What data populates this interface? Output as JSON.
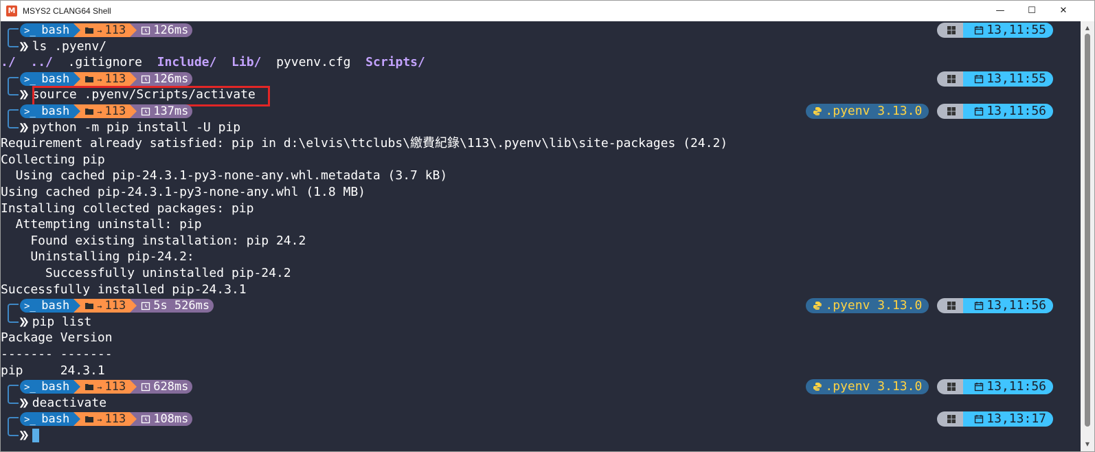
{
  "window": {
    "title": "MSYS2 CLANG64 Shell",
    "icon_letter": "M",
    "minimize_glyph": "—",
    "maximize_glyph": "☐",
    "close_glyph": "✕"
  },
  "prompt": {
    "shell": "bash",
    "dir": "113",
    "shell_icon": ">_",
    "dir_icon": "folder-arrow-icon",
    "timer_icon": "timer-icon",
    "os_icon": "windows-icon",
    "date_icon": "calendar-icon",
    "python_icon": "python-icon",
    "env": ".pyenv 3.13.0",
    "chevron": "❯❯"
  },
  "blocks": [
    {
      "time": "126ms",
      "clock": "13,11:55",
      "show_env": false,
      "command": "ls .pyenv/",
      "output_ls": [
        "./",
        "../",
        ".gitignore",
        "Include/",
        "Lib/",
        "pyvenv.cfg",
        "Scripts/"
      ]
    },
    {
      "time": "126ms",
      "clock": "13,11:55",
      "show_env": false,
      "command": "source .pyenv/Scripts/activate",
      "output": []
    },
    {
      "time": "137ms",
      "clock": "13,11:56",
      "show_env": true,
      "command": "python -m pip install -U pip",
      "output": [
        "Requirement already satisfied: pip in d:\\elvis\\ttclubs\\繳費紀錄\\113\\.pyenv\\lib\\site-packages (24.2)",
        "Collecting pip",
        "  Using cached pip-24.3.1-py3-none-any.whl.metadata (3.7 kB)",
        "Using cached pip-24.3.1-py3-none-any.whl (1.8 MB)",
        "Installing collected packages: pip",
        "  Attempting uninstall: pip",
        "    Found existing installation: pip 24.2",
        "    Uninstalling pip-24.2:",
        "      Successfully uninstalled pip-24.2",
        "Successfully installed pip-24.3.1"
      ]
    },
    {
      "time": "5s 526ms",
      "clock": "13,11:56",
      "show_env": true,
      "command": "pip list",
      "output": [
        "Package Version",
        "------- -------",
        "pip     24.3.1"
      ]
    },
    {
      "time": "628ms",
      "clock": "13,11:56",
      "show_env": true,
      "command": "deactivate",
      "output": []
    },
    {
      "time": "108ms",
      "clock": "13,13:17",
      "show_env": false,
      "command": "",
      "output": []
    }
  ],
  "colors": {
    "terminal_bg": "#282c3a",
    "bash_segment": "#1a77c0",
    "dir_segment": "#ff9248",
    "time_segment": "#856c9b",
    "python_pill": "#306998",
    "os_pill": "#b3b8c4",
    "date_pill": "#40c4ff",
    "directory_text": "#c4a3ff",
    "highlight_box": "#e22626"
  }
}
